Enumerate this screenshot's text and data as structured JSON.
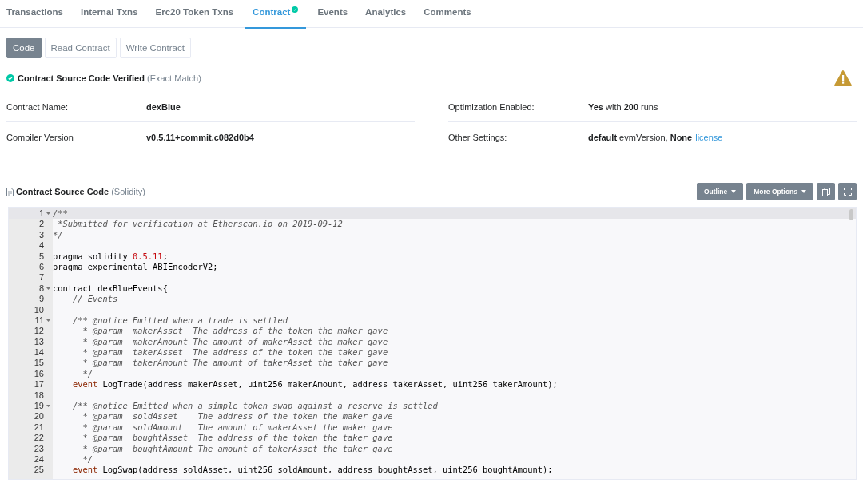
{
  "tabs": [
    {
      "label": "Transactions",
      "selected": false,
      "verified": false
    },
    {
      "label": "Internal Txns",
      "selected": false,
      "verified": false
    },
    {
      "label": "Erc20 Token Txns",
      "selected": false,
      "verified": false
    },
    {
      "label": "Contract",
      "selected": true,
      "verified": true
    },
    {
      "label": "Events",
      "selected": false,
      "verified": false
    },
    {
      "label": "Analytics",
      "selected": false,
      "verified": false
    },
    {
      "label": "Comments",
      "selected": false,
      "verified": false
    }
  ],
  "sub_tabs": [
    {
      "label": "Code",
      "selected": true
    },
    {
      "label": "Read Contract",
      "selected": false
    },
    {
      "label": "Write Contract",
      "selected": false
    }
  ],
  "verification": {
    "title": "Contract Source Code Verified",
    "note": "(Exact Match)"
  },
  "details": [
    {
      "label": "Contract Name:",
      "value": "dexBlue",
      "bold": true
    },
    {
      "label": "Optimization Enabled:",
      "value": "**Yes** with **200** runs",
      "bold": false
    },
    {
      "label": "Compiler Version",
      "value": "v0.5.11+commit.c082d0b4",
      "bold": true
    },
    {
      "label": "Other Settings:",
      "value": "**default** evmVersion, **None**",
      "bold": false,
      "link": "license"
    }
  ],
  "source": {
    "title": "Contract Source Code",
    "note": "(Solidity)",
    "buttons": [
      {
        "label": "Outline",
        "kind": "dropdown"
      },
      {
        "label": "More Options",
        "kind": "dropdown"
      },
      {
        "kind": "copy"
      },
      {
        "kind": "fullscreen"
      }
    ]
  },
  "code": [
    {
      "number": "1",
      "fold": true,
      "selected": true,
      "parts": [
        {
          "kind": "comment",
          "text": "/**"
        }
      ]
    },
    {
      "number": "2",
      "fold": false,
      "selected": false,
      "parts": [
        {
          "kind": "comment",
          "text": " *Submitted for verification at Etherscan.io on 2019-09-12"
        }
      ]
    },
    {
      "number": "3",
      "fold": false,
      "selected": false,
      "parts": [
        {
          "kind": "comment",
          "text": "*/"
        }
      ]
    },
    {
      "number": "4",
      "fold": false,
      "selected": false
    },
    {
      "number": "5",
      "fold": false,
      "selected": false,
      "parts": [
        {
          "kind": "plain",
          "text": "pragma solidity "
        },
        {
          "kind": "number",
          "text": "0.5.11"
        },
        {
          "kind": "plain",
          "text": ";"
        }
      ]
    },
    {
      "number": "6",
      "fold": false,
      "selected": false,
      "parts": [
        {
          "kind": "plain",
          "text": "pragma experimental ABIEncoderV2;"
        }
      ]
    },
    {
      "number": "7",
      "fold": false,
      "selected": false
    },
    {
      "number": "8",
      "fold": true,
      "selected": false,
      "parts": [
        {
          "kind": "plain",
          "text": "contract dexBlueEvents{"
        }
      ]
    },
    {
      "number": "9",
      "fold": false,
      "selected": false,
      "parts": [
        {
          "kind": "comment",
          "text": "    // Events"
        }
      ]
    },
    {
      "number": "10",
      "fold": false,
      "selected": false
    },
    {
      "number": "11",
      "fold": true,
      "selected": false,
      "parts": [
        {
          "kind": "comment",
          "text": "    /** @notice Emitted when a trade is settled"
        }
      ]
    },
    {
      "number": "12",
      "fold": false,
      "selected": false,
      "parts": [
        {
          "kind": "comment",
          "text": "      * @param  makerAsset  The address of the token the maker gave"
        }
      ]
    },
    {
      "number": "13",
      "fold": false,
      "selected": false,
      "parts": [
        {
          "kind": "comment",
          "text": "      * @param  makerAmount The amount of makerAsset the maker gave"
        }
      ]
    },
    {
      "number": "14",
      "fold": false,
      "selected": false,
      "parts": [
        {
          "kind": "comment",
          "text": "      * @param  takerAsset  The address of the token the taker gave"
        }
      ]
    },
    {
      "number": "15",
      "fold": false,
      "selected": false,
      "parts": [
        {
          "kind": "comment",
          "text": "      * @param  takerAmount The amount of takerAsset the taker gave"
        }
      ]
    },
    {
      "number": "16",
      "fold": false,
      "selected": false,
      "parts": [
        {
          "kind": "comment",
          "text": "      */"
        }
      ]
    },
    {
      "number": "17",
      "fold": false,
      "selected": false,
      "parts": [
        {
          "kind": "keyword",
          "text": "    event"
        },
        {
          "kind": "plain",
          "text": " LogTrade(address makerAsset, uint256 makerAmount, address takerAsset, uint256 takerAmount);"
        }
      ]
    },
    {
      "number": "18",
      "fold": false,
      "selected": false
    },
    {
      "number": "19",
      "fold": true,
      "selected": false,
      "parts": [
        {
          "kind": "comment",
          "text": "    /** @notice Emitted when a simple token swap against a reserve is settled"
        }
      ]
    },
    {
      "number": "20",
      "fold": false,
      "selected": false,
      "parts": [
        {
          "kind": "comment",
          "text": "      * @param  soldAsset    The address of the token the maker gave"
        }
      ]
    },
    {
      "number": "21",
      "fold": false,
      "selected": false,
      "parts": [
        {
          "kind": "comment",
          "text": "      * @param  soldAmount   The amount of makerAsset the maker gave"
        }
      ]
    },
    {
      "number": "22",
      "fold": false,
      "selected": false,
      "parts": [
        {
          "kind": "comment",
          "text": "      * @param  boughtAsset  The address of the token the taker gave"
        }
      ]
    },
    {
      "number": "23",
      "fold": false,
      "selected": false,
      "parts": [
        {
          "kind": "comment",
          "text": "      * @param  boughtAmount The amount of takerAsset the taker gave"
        }
      ]
    },
    {
      "number": "24",
      "fold": false,
      "selected": false,
      "parts": [
        {
          "kind": "comment",
          "text": "      */"
        }
      ]
    },
    {
      "number": "25",
      "fold": false,
      "selected": false,
      "parts": [
        {
          "kind": "keyword",
          "text": "    event"
        },
        {
          "kind": "plain",
          "text": " LogSwap(address soldAsset, uint256 soldAmount, address boughtAsset, uint256 boughtAmount);"
        }
      ]
    }
  ]
}
